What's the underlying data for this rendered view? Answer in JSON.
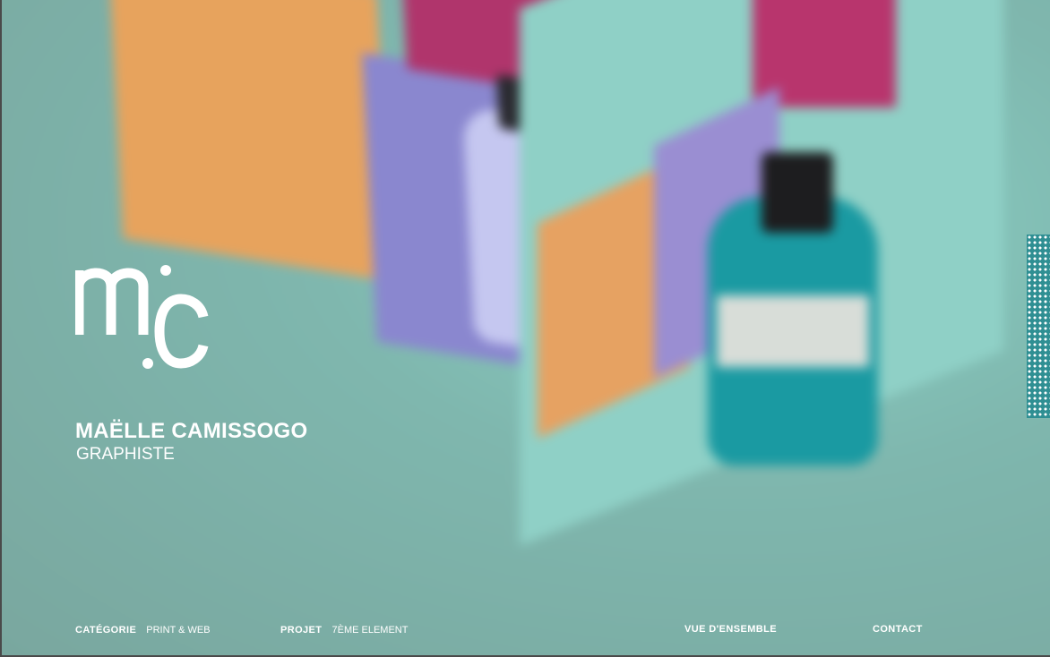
{
  "identity": {
    "name": "MAËLLE CAMISSOGO",
    "role": "GRAPHISTE"
  },
  "footer": {
    "category_label": "CATÉGORIE",
    "category_value": "PRINT & WEB",
    "project_label": "PROJET",
    "project_value": "7ÈME ELEMENT",
    "overview_link": "VUE D'ENSEMBLE",
    "contact_link": "CONTACT"
  },
  "colors": {
    "background": "#7fb0a7",
    "text": "#ffffff",
    "accent_orange": "#e7a35d",
    "accent_purple": "#8a87cf",
    "accent_pink": "#b0356c",
    "accent_teal": "#1a9aa2"
  },
  "icons": {
    "logo": "mc-monogram-logo",
    "side_pattern": "dotted-pattern-strip"
  }
}
